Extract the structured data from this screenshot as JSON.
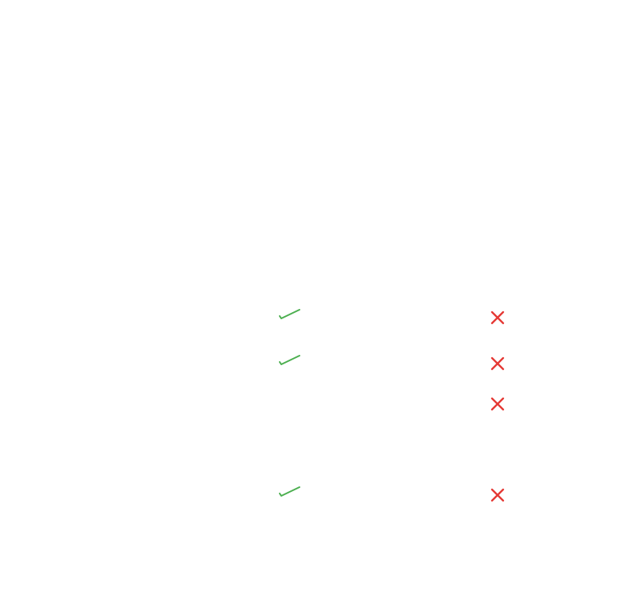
{
  "comparison": {
    "rows": [
      {
        "left_icon": "check-icon",
        "right_icon": "cross-icon"
      },
      {
        "left_icon": "check-icon",
        "right_icon": "cross-icon"
      },
      {
        "left_icon": null,
        "right_icon": "cross-icon"
      },
      {
        "left_icon": "check-icon",
        "right_icon": "cross-icon"
      }
    ]
  },
  "colors": {
    "background": "#ffffff",
    "check": "#4caf50",
    "cross": "#e53935"
  }
}
